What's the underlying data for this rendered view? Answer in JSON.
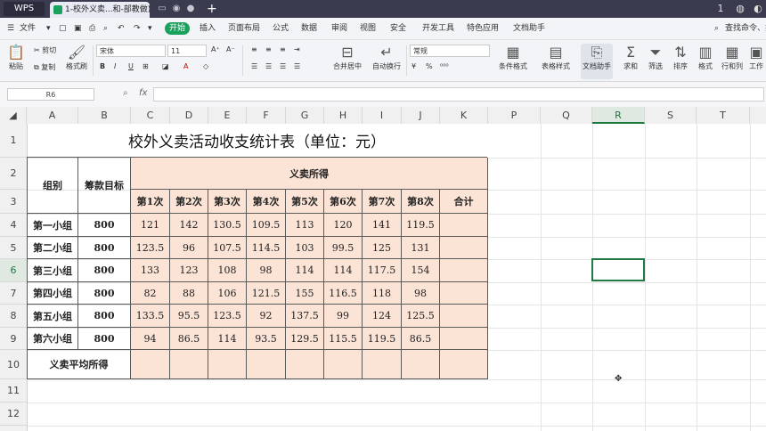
{
  "titlebar": {
    "app": "WPS",
    "doc_tab": "1-校外义卖...和-部教做)"
  },
  "menu": {
    "file": "文件",
    "start": "开始",
    "items": [
      "插入",
      "页面布局",
      "公式",
      "数据",
      "审阅",
      "视图",
      "安全",
      "开发工具",
      "特色应用",
      "文档助手"
    ],
    "search": "查找命令、搜"
  },
  "ribbon": {
    "paste": "粘贴",
    "cut": "剪切",
    "copy": "复制",
    "format_painter": "格式刷",
    "font_name": "宋体",
    "font_size": "11",
    "merge_center": "合并居中",
    "wrap_text": "自动换行",
    "number_format": "常规",
    "conditional_format": "条件格式",
    "table_style": "表格样式",
    "doc_assistant": "文档助手",
    "sum": "求和",
    "filter": "筛选",
    "sort": "排序",
    "format": "格式",
    "row_col": "行和列",
    "work": "工作"
  },
  "formula_bar": {
    "name_box": "R6",
    "fx": "fx",
    "value": ""
  },
  "sheet": {
    "columns": [
      "A",
      "B",
      "C",
      "D",
      "E",
      "F",
      "G",
      "H",
      "I",
      "J",
      "K",
      "P",
      "Q",
      "R",
      "S",
      "T"
    ],
    "selected_column": "R",
    "rows": [
      "1",
      "2",
      "3",
      "4",
      "5",
      "6",
      "7",
      "8",
      "9",
      "10",
      "11",
      "12"
    ],
    "selected_row": "6",
    "title": "校外义卖活动收支统计表（单位：元）",
    "header_group": "组别",
    "header_target": "筹款目标",
    "header_income": "义卖所得",
    "times": [
      "第1次",
      "第2次",
      "第3次",
      "第4次",
      "第5次",
      "第6次",
      "第7次",
      "第8次"
    ],
    "total_label": "合计",
    "data_rows": [
      {
        "group": "第一小组",
        "target": "800",
        "values": [
          "121",
          "142",
          "130.5",
          "109.5",
          "113",
          "120",
          "141",
          "119.5"
        ],
        "total": ""
      },
      {
        "group": "第二小组",
        "target": "800",
        "values": [
          "123.5",
          "96",
          "107.5",
          "114.5",
          "103",
          "99.5",
          "125",
          "131"
        ],
        "total": ""
      },
      {
        "group": "第三小组",
        "target": "800",
        "values": [
          "133",
          "123",
          "108",
          "98",
          "114",
          "114",
          "117.5",
          "154"
        ],
        "total": ""
      },
      {
        "group": "第四小组",
        "target": "800",
        "values": [
          "82",
          "88",
          "106",
          "121.5",
          "155",
          "116.5",
          "118",
          "98"
        ],
        "total": ""
      },
      {
        "group": "第五小组",
        "target": "800",
        "values": [
          "133.5",
          "95.5",
          "123.5",
          "92",
          "137.5",
          "99",
          "124",
          "125.5"
        ],
        "total": ""
      },
      {
        "group": "第六小组",
        "target": "800",
        "values": [
          "94",
          "86.5",
          "114",
          "93.5",
          "129.5",
          "115.5",
          "119.5",
          "86.5"
        ],
        "total": ""
      }
    ],
    "avg_label": "义卖平均所得"
  },
  "colors": {
    "accent": "#1aa15c",
    "table_fill": "#fbe3d6",
    "selection": "#1f7a43",
    "titlebar": "#3b3b4f"
  }
}
